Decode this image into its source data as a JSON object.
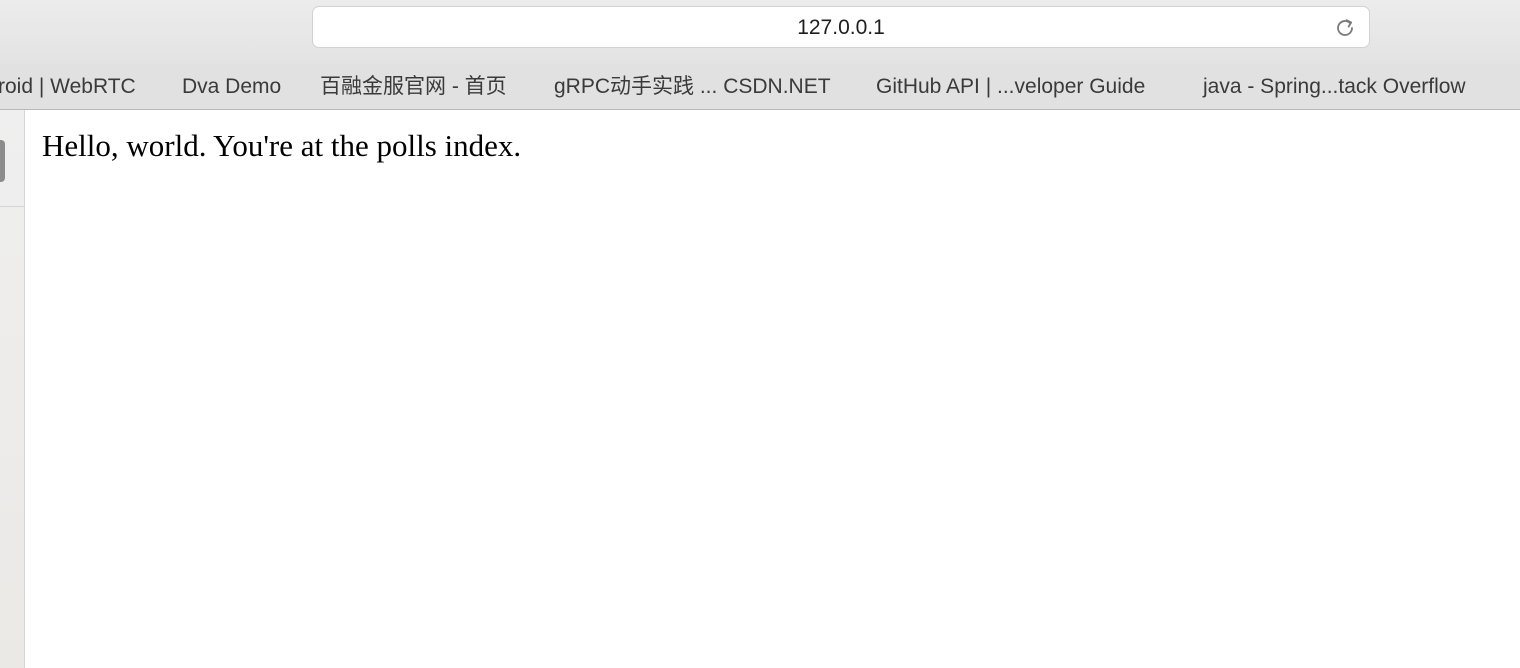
{
  "address_bar": {
    "url": "127.0.0.1"
  },
  "bookmarks": [
    {
      "label": "roid | WebRTC"
    },
    {
      "label": "Dva Demo"
    },
    {
      "label": "百融金服官网 - 首页"
    },
    {
      "label": "gRPC动手实践 ... CSDN.NET"
    },
    {
      "label": "GitHub API | ...veloper Guide"
    },
    {
      "label": "java - Spring...tack Overflow"
    }
  ],
  "page": {
    "text": "Hello, world. You're at the polls index."
  }
}
